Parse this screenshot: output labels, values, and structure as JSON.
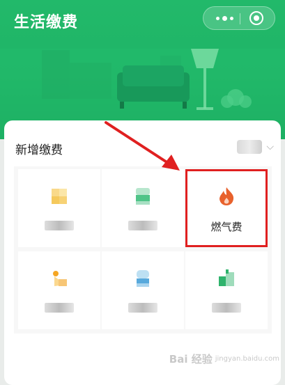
{
  "header": {
    "title": "生活缴费"
  },
  "section": {
    "title": "新增缴费"
  },
  "tiles": [
    {
      "id": "tile-1",
      "label": "",
      "icon": "electricity-icon"
    },
    {
      "id": "tile-2",
      "label": "",
      "icon": "water-icon"
    },
    {
      "id": "tile-3",
      "label": "燃气费",
      "icon": "gas-flame-icon",
      "highlighted": true
    },
    {
      "id": "tile-4",
      "label": "",
      "icon": "phone-bill-icon"
    },
    {
      "id": "tile-5",
      "label": "",
      "icon": "broadband-icon"
    },
    {
      "id": "tile-6",
      "label": "",
      "icon": "tv-icon"
    }
  ],
  "watermark": {
    "text": "Bai 经验",
    "sub": "jingyan.baidu.com"
  },
  "colors": {
    "brand": "#1fb466",
    "highlight": "#e02020",
    "flame": "#e8612c"
  }
}
